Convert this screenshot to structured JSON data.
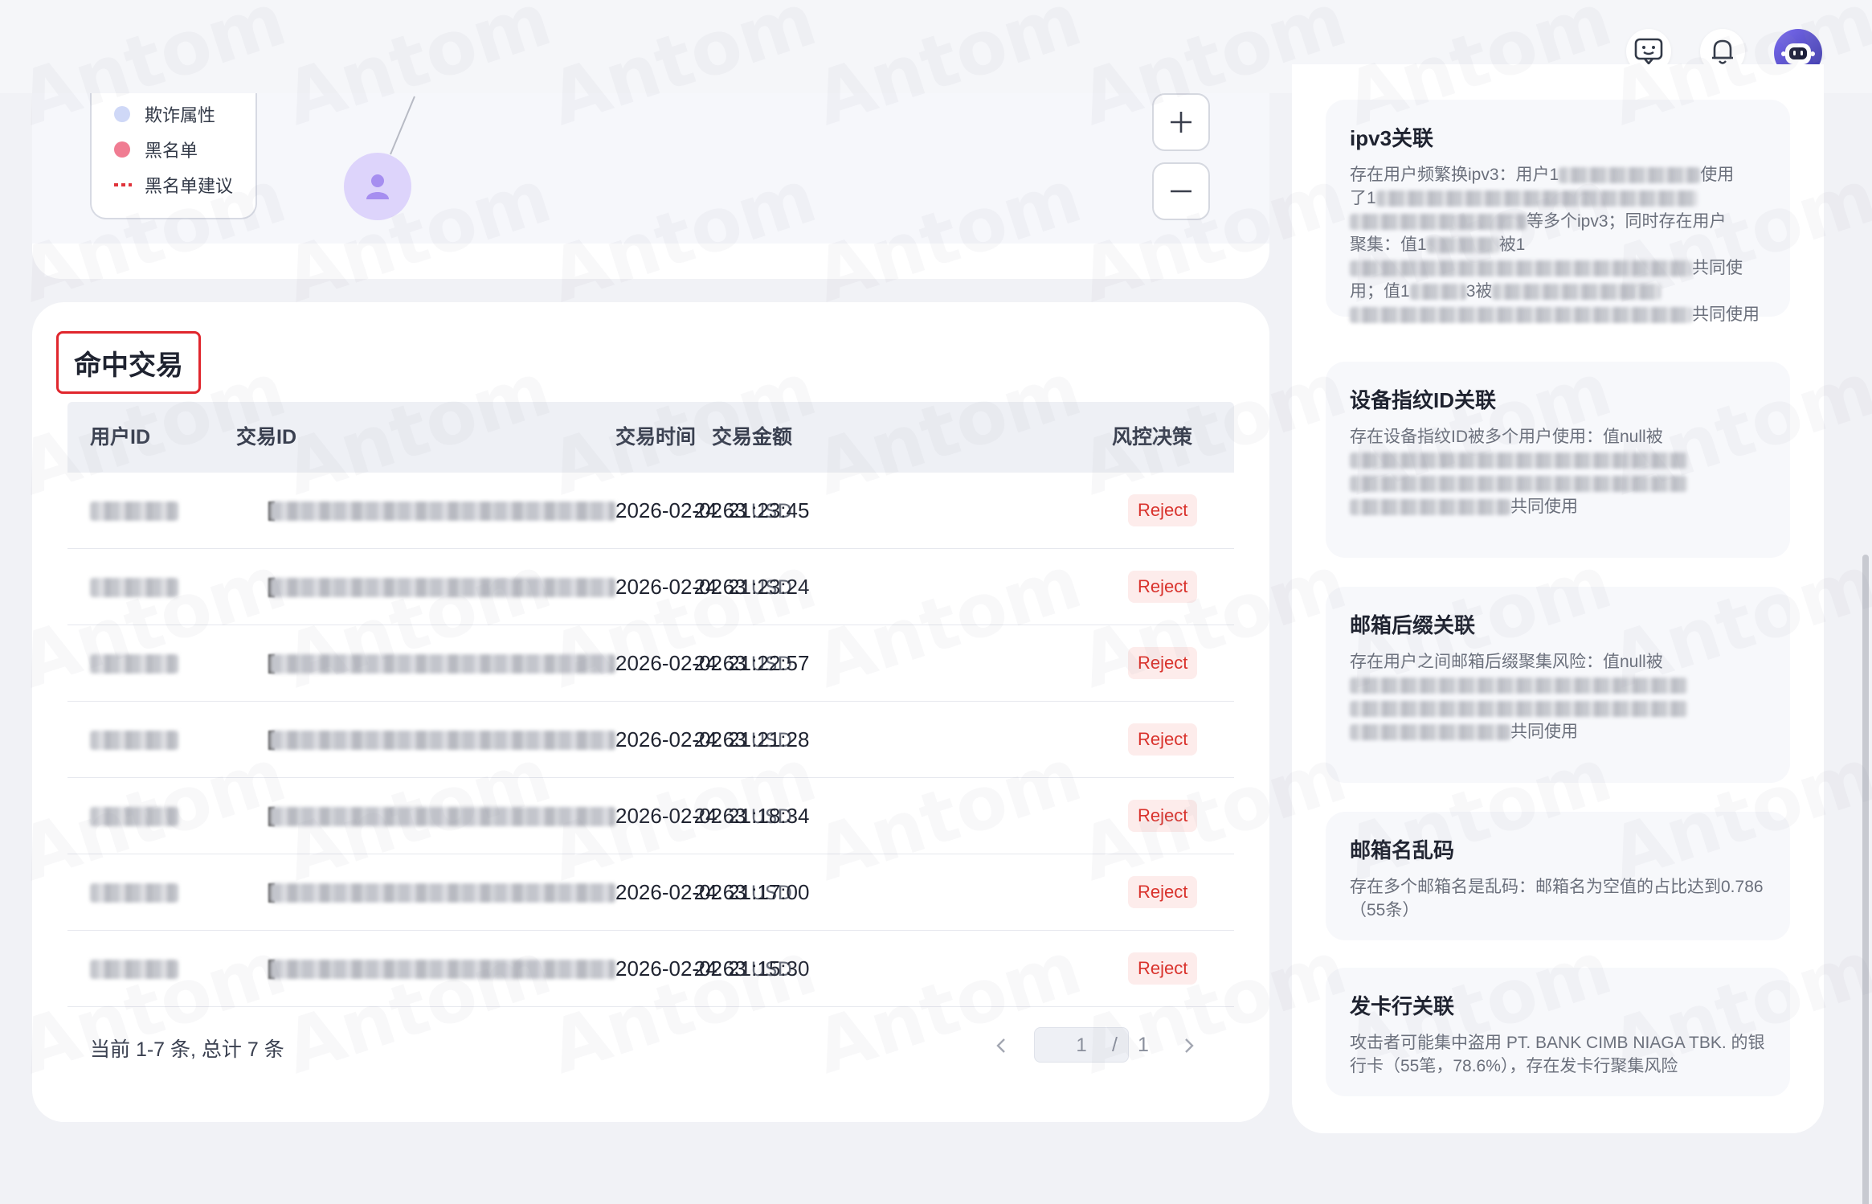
{
  "graph": {
    "legend": [
      {
        "label": "欺诈属性",
        "color": "#cfd8f7",
        "kind": "dot"
      },
      {
        "label": "黑名单",
        "color": "#f07c92",
        "kind": "dot"
      },
      {
        "label": "黑名单建议",
        "color": "#e0323a",
        "kind": "dash"
      }
    ],
    "zoom_in": "+",
    "zoom_out": "−"
  },
  "transactions": {
    "title": "命中交易",
    "columns": {
      "user_id": "用户ID",
      "tx_id": "交易ID",
      "amount": "交易金额",
      "time": "交易时间",
      "decision": "风控决策"
    },
    "rows": [
      {
        "amount": "24.63",
        "currency": "USD",
        "time": "2026-02-02 21:23:45",
        "decision": "Reject"
      },
      {
        "amount": "24.63",
        "currency": "USD",
        "time": "2026-02-02 21:23:24",
        "decision": "Reject"
      },
      {
        "amount": "24.63",
        "currency": "USD",
        "time": "2026-02-02 21:22:57",
        "decision": "Reject"
      },
      {
        "amount": "24.63",
        "currency": "USD",
        "time": "2026-02-02 21:21:28",
        "decision": "Reject"
      },
      {
        "amount": "24.63",
        "currency": "USD",
        "time": "2026-02-02 21:18:34",
        "decision": "Reject"
      },
      {
        "amount": "24.63",
        "currency": "USD",
        "time": "2026-02-02 21:17:00",
        "decision": "Reject"
      },
      {
        "amount": "24.63",
        "currency": "USD",
        "time": "2026-02-02 21:15:30",
        "decision": "Reject"
      }
    ],
    "pagination": {
      "summary": "当前 1-7 条, 总计 7 条",
      "current_page": "1",
      "separator": "/",
      "total_pages": "1"
    }
  },
  "risks": {
    "ipv3": {
      "title": "ipv3关联",
      "desc_1": "存在用户频繁换ipv3：用户1",
      "desc_2": "使用",
      "desc_3": "了1",
      "desc_4": "等多个ipv3；同时存在用户",
      "desc_5": "聚集：值1",
      "desc_6": "被1",
      "desc_7": "共同使",
      "desc_8": "用；值1",
      "desc_9": "3被",
      "desc_10": "共同使用"
    },
    "device": {
      "title": "设备指纹ID关联",
      "desc_1": "存在设备指纹ID被多个用户使用：值null被",
      "desc_2": "共同使用"
    },
    "email_suffix": {
      "title": "邮箱后缀关联",
      "desc_1": "存在用户之间邮箱后缀聚集风险：值null被",
      "desc_2": "共同使用"
    },
    "email_garbled": {
      "title": "邮箱名乱码",
      "desc": "存在多个邮箱名是乱码：邮箱名为空值的占比达到0.786（55条）"
    },
    "issuer": {
      "title": "发卡行关联",
      "desc": "攻击者可能集中盗用 PT. BANK CIMB NIAGA TBK. 的银行卡（55笔，78.6%），存在发卡行聚集风险"
    }
  },
  "icons": {
    "chat": "chat-bubble-icon",
    "notification": "bell-icon",
    "user": "robot-avatar-icon"
  },
  "colors": {
    "reject_bg": "#fdeceb",
    "reject_text": "#d9322c",
    "title_border": "#e0262d"
  }
}
